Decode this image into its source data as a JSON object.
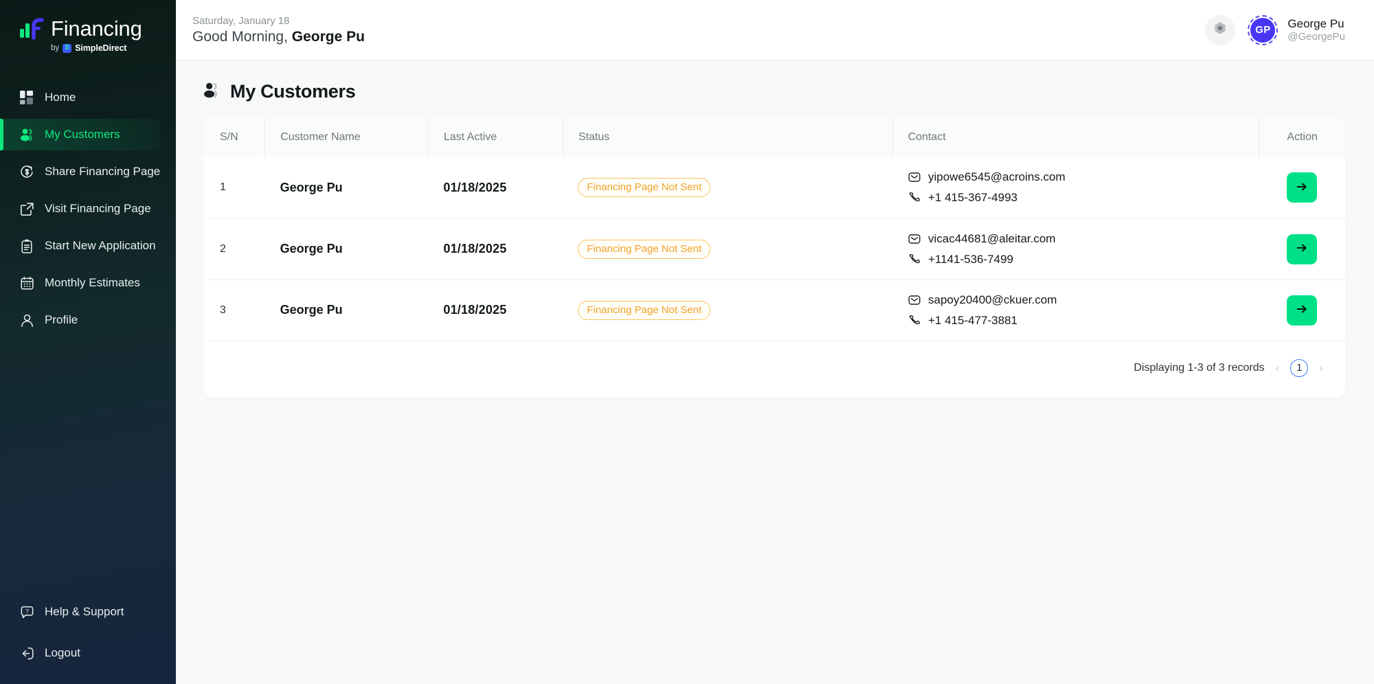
{
  "brand": {
    "name": "Financing",
    "by_label": "by",
    "company": "SimpleDirect",
    "mark_letter": "S",
    "logo_icon": "bar-chart-logo-icon",
    "accent_green": "#0ee87f",
    "accent_blue": "#3d5afe"
  },
  "sidebar": {
    "items": [
      {
        "label": "Home",
        "icon": "grid-home-icon",
        "active": false
      },
      {
        "label": "My Customers",
        "icon": "users-icon",
        "active": true
      },
      {
        "label": "Share Financing Page",
        "icon": "dollar-share-icon",
        "active": false
      },
      {
        "label": "Visit Financing Page",
        "icon": "external-link-icon",
        "active": false
      },
      {
        "label": "Start New Application",
        "icon": "clipboard-icon",
        "active": false
      },
      {
        "label": "Monthly Estimates",
        "icon": "calendar-icon",
        "active": false
      },
      {
        "label": "Profile",
        "icon": "user-icon",
        "active": false
      }
    ],
    "bottom_items": [
      {
        "label": "Help & Support",
        "icon": "help-chat-icon"
      },
      {
        "label": "Logout",
        "icon": "logout-icon"
      }
    ]
  },
  "topbar": {
    "date": "Saturday, January 18",
    "greeting_prefix": "Good Morning, ",
    "greeting_name": "George Pu",
    "settings_icon": "settings-hex-icon",
    "user": {
      "initials": "GP",
      "name": "George Pu",
      "handle": "@GeorgePu"
    }
  },
  "page": {
    "title": "My Customers",
    "title_icon": "users-icon"
  },
  "table": {
    "columns": [
      "S/N",
      "Customer Name",
      "Last Active",
      "Status",
      "Contact",
      "Action"
    ],
    "rows": [
      {
        "sn": "1",
        "name": "George Pu",
        "last_active": "01/18/2025",
        "status": "Financing Page Not Sent",
        "email": "yipowe6545@acroins.com",
        "phone": "+1 415-367-4993",
        "action_icon": "arrow-right-icon"
      },
      {
        "sn": "2",
        "name": "George Pu",
        "last_active": "01/18/2025",
        "status": "Financing Page Not Sent",
        "email": "vicac44681@aleitar.com",
        "phone": "+1141-536-7499",
        "action_icon": "arrow-right-icon"
      },
      {
        "sn": "3",
        "name": "George Pu",
        "last_active": "01/18/2025",
        "status": "Financing Page Not Sent",
        "email": "sapoy20400@ckuer.com",
        "phone": "+1 415-477-3881",
        "action_icon": "arrow-right-icon"
      }
    ],
    "status_color": "#f0a32a",
    "action_button_color": "#00e187"
  },
  "pagination": {
    "summary": "Displaying 1-3 of 3 records",
    "prev_icon": "chevron-left-icon",
    "next_icon": "chevron-right-icon",
    "current_page": "1"
  }
}
